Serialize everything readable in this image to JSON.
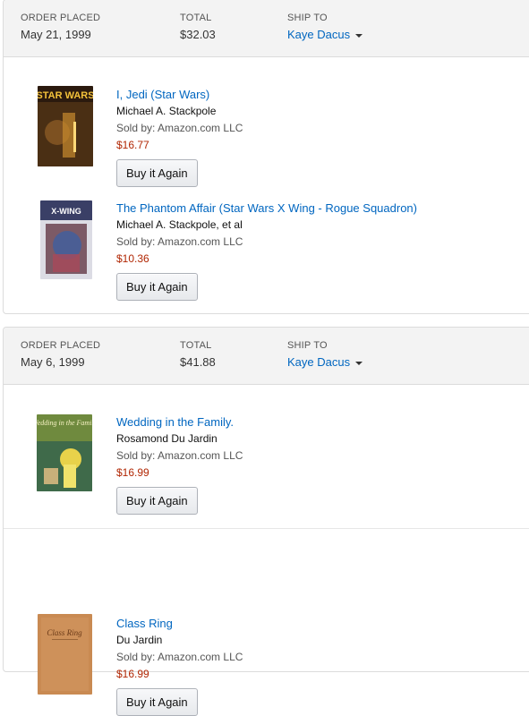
{
  "orders": [
    {
      "placed_label": "ORDER PLACED",
      "placed_value": "May 21, 1999",
      "total_label": "TOTAL",
      "total_value": "$32.03",
      "ship_label": "SHIP TO",
      "ship_value": "Kaye Dacus",
      "items": [
        {
          "title": "I, Jedi (Star Wars)",
          "author": "Michael A. Stackpole",
          "seller": "Sold by: Amazon.com LLC",
          "price": "$16.77",
          "button": "Buy it Again"
        },
        {
          "title": "The Phantom Affair (Star Wars X Wing - Rogue Squadron)",
          "author": "Michael A. Stackpole, et al",
          "seller": "Sold by: Amazon.com LLC",
          "price": "$10.36",
          "button": "Buy it Again"
        }
      ]
    },
    {
      "placed_label": "ORDER PLACED",
      "placed_value": "May 6, 1999",
      "total_label": "TOTAL",
      "total_value": "$41.88",
      "ship_label": "SHIP TO",
      "ship_value": "Kaye Dacus",
      "items": [
        {
          "title": "Wedding in the Family.",
          "author": "Rosamond Du Jardin",
          "seller": "Sold by: Amazon.com LLC",
          "price": "$16.99",
          "button": "Buy it Again"
        },
        {
          "title": "Class Ring",
          "author": "Du Jardin",
          "seller": "Sold by: Amazon.com LLC",
          "price": "$16.99",
          "button": "Buy it Again"
        }
      ]
    }
  ],
  "covers": {
    "cover1_text": "STAR WARS",
    "cover2_text": "X-WING",
    "cover3_text": "Wedding in the Family",
    "cover4_text": "Class Ring"
  }
}
